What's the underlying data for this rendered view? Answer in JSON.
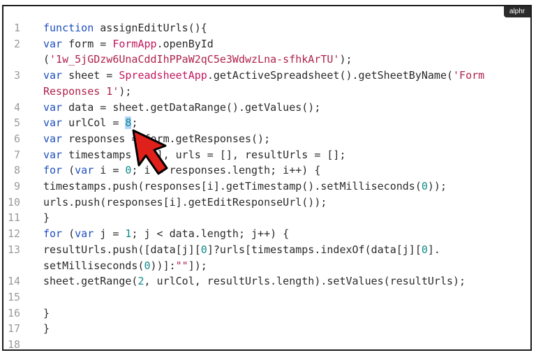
{
  "brand": {
    "badge": "alphr"
  },
  "code": {
    "lines": [
      {
        "n": "1",
        "segs": [
          {
            "t": "function",
            "c": "kw"
          },
          {
            "t": " assignEditUrls(){",
            "c": ""
          }
        ]
      },
      {
        "n": "2",
        "segs": [
          {
            "t": "var",
            "c": "kw"
          },
          {
            "t": " form = ",
            "c": ""
          },
          {
            "t": "FormApp",
            "c": "cls"
          },
          {
            "t": ".openById",
            "c": ""
          }
        ]
      },
      {
        "n": "",
        "segs": [
          {
            "t": "(",
            "c": ""
          },
          {
            "t": "'1w_5jGDzw6UnaCddIhPPaW2qC5e3WdwzLna-sfhkArTU'",
            "c": "str"
          },
          {
            "t": ");",
            "c": ""
          }
        ]
      },
      {
        "n": "3",
        "segs": [
          {
            "t": "var",
            "c": "kw"
          },
          {
            "t": " sheet = ",
            "c": ""
          },
          {
            "t": "SpreadsheetApp",
            "c": "cls"
          },
          {
            "t": ".getActiveSpreadsheet().getSheetByName(",
            "c": ""
          },
          {
            "t": "'Form",
            "c": "str"
          }
        ]
      },
      {
        "n": "",
        "segs": [
          {
            "t": "Responses 1'",
            "c": "str"
          },
          {
            "t": ");",
            "c": ""
          }
        ]
      },
      {
        "n": "4",
        "segs": [
          {
            "t": "var",
            "c": "kw"
          },
          {
            "t": " data = sheet.getDataRange().getValues();",
            "c": ""
          }
        ]
      },
      {
        "n": "5",
        "segs": [
          {
            "t": "var",
            "c": "kw"
          },
          {
            "t": " urlCol = ",
            "c": ""
          },
          {
            "t": "8",
            "c": "num hl"
          },
          {
            "t": ";",
            "c": ""
          }
        ]
      },
      {
        "n": "6",
        "segs": [
          {
            "t": "var",
            "c": "kw"
          },
          {
            "t": " responses = form.getResponses();",
            "c": ""
          }
        ]
      },
      {
        "n": "7",
        "segs": [
          {
            "t": "var",
            "c": "kw"
          },
          {
            "t": " timestamps = [], urls = [], resultUrls = [];",
            "c": ""
          }
        ]
      },
      {
        "n": "8",
        "segs": [
          {
            "t": "for",
            "c": "kw"
          },
          {
            "t": " (",
            "c": ""
          },
          {
            "t": "var",
            "c": "kw"
          },
          {
            "t": " i = ",
            "c": ""
          },
          {
            "t": "0",
            "c": "num"
          },
          {
            "t": "; i < responses.length; i++) {",
            "c": ""
          }
        ]
      },
      {
        "n": "9",
        "segs": [
          {
            "t": "timestamps.push(responses[i].getTimestamp().setMilliseconds(",
            "c": ""
          },
          {
            "t": "0",
            "c": "num"
          },
          {
            "t": "));",
            "c": ""
          }
        ]
      },
      {
        "n": "10",
        "segs": [
          {
            "t": "urls.push(responses[i].getEditResponseUrl());",
            "c": ""
          }
        ]
      },
      {
        "n": "11",
        "segs": [
          {
            "t": "}",
            "c": ""
          }
        ]
      },
      {
        "n": "12",
        "segs": [
          {
            "t": "for",
            "c": "kw"
          },
          {
            "t": " (",
            "c": ""
          },
          {
            "t": "var",
            "c": "kw"
          },
          {
            "t": " j = ",
            "c": ""
          },
          {
            "t": "1",
            "c": "num"
          },
          {
            "t": "; j < data.length; j++) {",
            "c": ""
          }
        ]
      },
      {
        "n": "13",
        "segs": [
          {
            "t": "resultUrls.push([data[j][",
            "c": ""
          },
          {
            "t": "0",
            "c": "num"
          },
          {
            "t": "]?urls[timestamps.indexOf(data[j][",
            "c": ""
          },
          {
            "t": "0",
            "c": "num"
          },
          {
            "t": "].",
            "c": ""
          }
        ]
      },
      {
        "n": "",
        "segs": [
          {
            "t": "setMilliseconds(",
            "c": ""
          },
          {
            "t": "0",
            "c": "num"
          },
          {
            "t": "))]:",
            "c": ""
          },
          {
            "t": "\"\"",
            "c": "str"
          },
          {
            "t": "]);",
            "c": ""
          }
        ]
      },
      {
        "n": "14",
        "segs": [
          {
            "t": "sheet.getRange(",
            "c": ""
          },
          {
            "t": "2",
            "c": "num"
          },
          {
            "t": ", urlCol, resultUrls.length).setValues(resultUrls);",
            "c": ""
          }
        ]
      },
      {
        "n": "15",
        "segs": []
      },
      {
        "n": "16",
        "segs": [
          {
            "t": "}",
            "c": ""
          }
        ]
      },
      {
        "n": "17",
        "segs": [
          {
            "t": "}",
            "c": ""
          }
        ]
      },
      {
        "n": "18",
        "segs": []
      }
    ]
  },
  "colors": {
    "keyword": "#1f4fbf",
    "class": "#c2185b",
    "string": "#b0214d",
    "number": "#0f8a8a",
    "arrow": "#e0201b",
    "selection": "#b3d4fc"
  },
  "icons": {
    "pointer": "red-arrow-icon"
  }
}
